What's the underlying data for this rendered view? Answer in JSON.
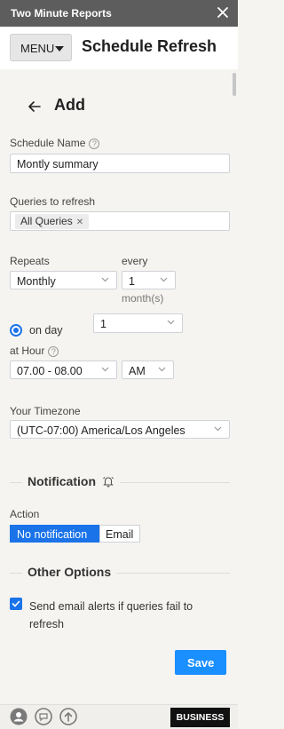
{
  "titlebar": {
    "title": "Two Minute Reports"
  },
  "header": {
    "menu_label": "MENU",
    "app_title": "Schedule Refresh"
  },
  "page": {
    "heading": "Add"
  },
  "schedule_name": {
    "label": "Schedule Name",
    "value": "Montly summary"
  },
  "queries": {
    "label": "Queries to refresh",
    "chips": [
      "All Queries"
    ]
  },
  "repeats": {
    "label": "Repeats",
    "value": "Monthly"
  },
  "every": {
    "label": "every",
    "value": "1",
    "unit": "month(s)"
  },
  "on_day": {
    "label": "on day",
    "value": "1"
  },
  "at_hour": {
    "label": "at Hour",
    "hour_value": "07.00 - 08.00",
    "ampm_value": "AM"
  },
  "timezone": {
    "label": "Your Timezone",
    "value": "(UTC-07:00) America/Los Angeles"
  },
  "notification": {
    "section_title": "Notification",
    "action_label": "Action",
    "options": [
      "No notification",
      "Email"
    ],
    "selected": "No notification"
  },
  "other_options": {
    "section_title": "Other Options",
    "alert_label_line1": "Send email alerts if queries fail to",
    "alert_label_line2": "refresh",
    "alert_checked": true
  },
  "actions": {
    "save_label": "Save"
  },
  "footer": {
    "plan_badge": "BUSINESS",
    "icons": [
      "account-icon",
      "chat-icon",
      "upgrade-icon"
    ]
  },
  "colors": {
    "accent": "#1a73e8",
    "save": "#1a8fff",
    "titlebar": "#5d5d5d"
  }
}
